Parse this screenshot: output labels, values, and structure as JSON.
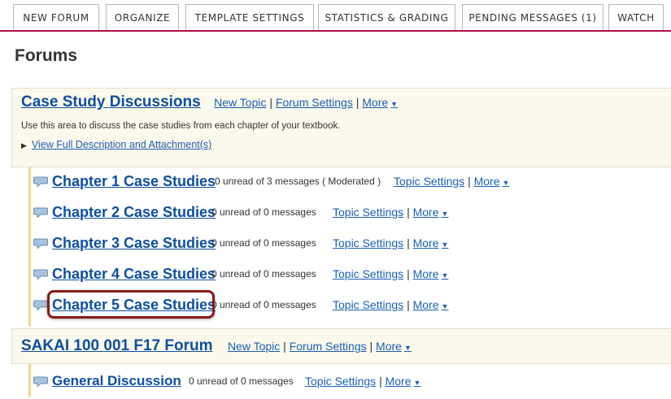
{
  "tabs": [
    {
      "label": "NEW FORUM"
    },
    {
      "label": "ORGANIZE"
    },
    {
      "label": "TEMPLATE SETTINGS"
    },
    {
      "label": "STATISTICS & GRADING"
    },
    {
      "label": "PENDING MESSAGES (1)"
    },
    {
      "label": "WATCH"
    }
  ],
  "page_title": "Forums",
  "forums": [
    {
      "title": "Case Study Discussions",
      "new_topic": "New Topic",
      "sep1": "|",
      "forum_settings": "Forum Settings",
      "sep2": "|",
      "more": "More",
      "description": "Use this area to discuss the case studies from each chapter of your textbook.",
      "view_full": "View Full Description and Attachment(s)",
      "topics": [
        {
          "title": "Chapter 1 Case Studies",
          "meta": "0 unread of 3 messages ( Moderated )",
          "settings": "Topic Settings",
          "sep": "|",
          "more": "More"
        },
        {
          "title": "Chapter 2 Case Studies",
          "meta": "0 unread of 0 messages",
          "settings": "Topic Settings",
          "sep": "|",
          "more": "More"
        },
        {
          "title": "Chapter 3 Case Studies",
          "meta": "0 unread of 0 messages",
          "settings": "Topic Settings",
          "sep": "|",
          "more": "More"
        },
        {
          "title": "Chapter 4 Case Studies",
          "meta": "0 unread of 0 messages",
          "settings": "Topic Settings",
          "sep": "|",
          "more": "More"
        },
        {
          "title": "Chapter 5 Case Studies",
          "meta": "0 unread of 0 messages",
          "settings": "Topic Settings",
          "sep": "|",
          "more": "More"
        }
      ]
    },
    {
      "title": "SAKAI 100 001 F17 Forum",
      "new_topic": "New Topic",
      "sep1": "|",
      "forum_settings": "Forum Settings",
      "sep2": "|",
      "more": "More",
      "topics": [
        {
          "title": "General Discussion",
          "meta": "0 unread of 0 messages",
          "settings": "Topic Settings",
          "sep": "|",
          "more": "More"
        }
      ]
    }
  ],
  "icons": {
    "caret": "caret-down-icon",
    "bubble": "speech-bubble-icon",
    "triangle": "disclosure-triangle-icon"
  },
  "colors": {
    "accent": "#b0123f",
    "link": "#1a5fb4",
    "highlight": "#8b1a1a",
    "forum_bg": "#fbf8ec"
  }
}
